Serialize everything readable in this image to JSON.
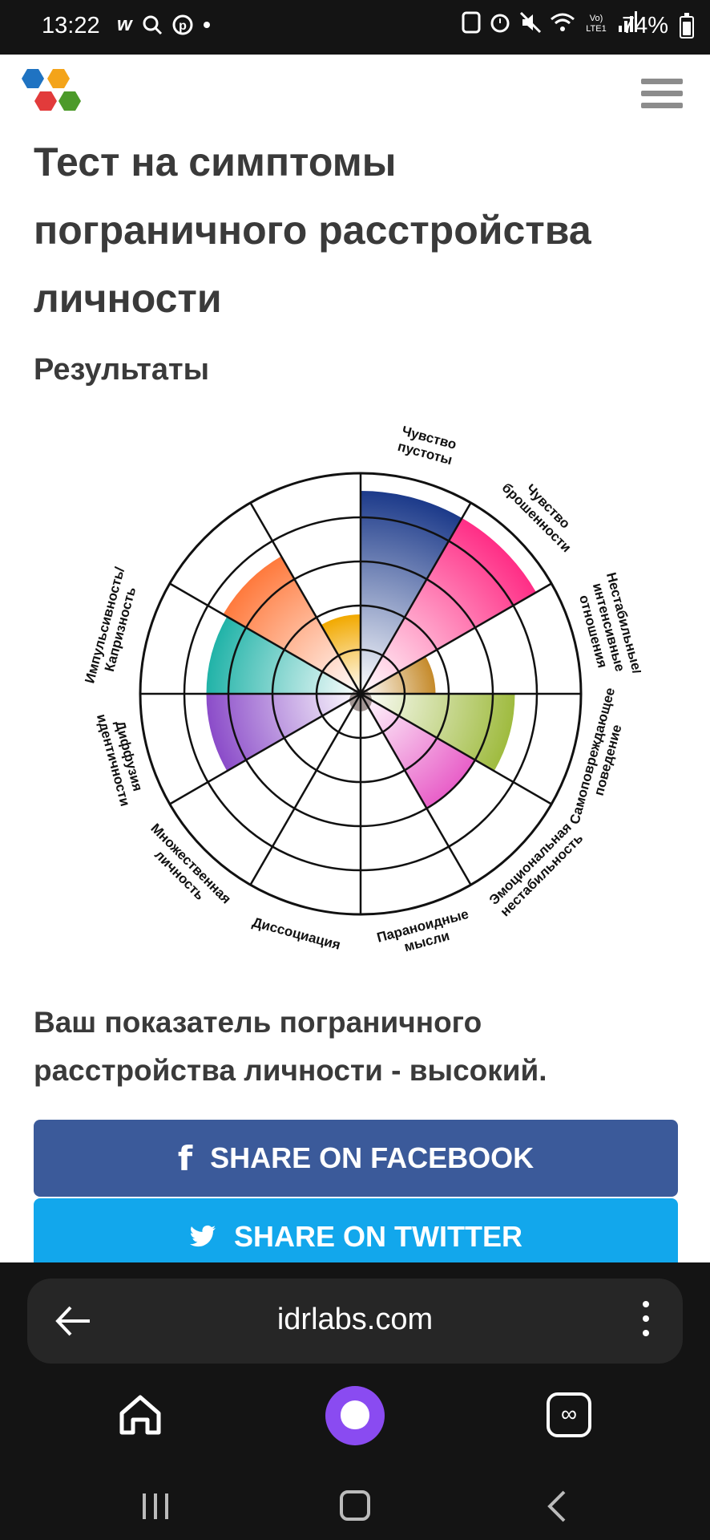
{
  "status_bar": {
    "time": "13:22",
    "battery": "74%",
    "left_icons": [
      "w-app-icon",
      "search-icon",
      "pinterest-icon",
      "dot-icon"
    ],
    "right_icons": [
      "screenshot-icon",
      "alarm-icon",
      "mute-icon",
      "wifi-icon",
      "volte-icon",
      "signal-icon"
    ]
  },
  "header": {
    "logo_icon": "hexagon-logo-icon",
    "menu_icon": "hamburger-menu-icon"
  },
  "content": {
    "title": "Тест на симптомы пограничного расстройства личности",
    "results_heading": "Результаты",
    "score_text": "Ваш показатель пограничного расстройства личности - высокий."
  },
  "chart_data": {
    "type": "polar-area",
    "max": 5,
    "categories": [
      {
        "label": [
          "Чувство",
          "пустоты"
        ],
        "value": 4.6,
        "color": "#1c3a8a"
      },
      {
        "label": [
          "Чувство",
          "брошенности"
        ],
        "value": 4.6,
        "color": "#ff2e86"
      },
      {
        "label": [
          "Нестабильные/",
          "интенсивные",
          "отношения"
        ],
        "value": 1.7,
        "color": "#c58a2a"
      },
      {
        "label": [
          "Самоповреждающее",
          "поведение"
        ],
        "value": 3.5,
        "color": "#9fbb3f"
      },
      {
        "label": [
          "Эмоциональная",
          "нестабильность"
        ],
        "value": 3.0,
        "color": "#e85fc8"
      },
      {
        "label": [
          "Параноидные",
          "мысли"
        ],
        "value": 0.0,
        "color": "#dddddd"
      },
      {
        "label": [
          "Диссоциация"
        ],
        "value": 0.0,
        "color": "#dddddd"
      },
      {
        "label": [
          "Множественная",
          "личность"
        ],
        "value": 0.0,
        "color": "#dddddd"
      },
      {
        "label": [
          "Диффузия",
          "идентичности"
        ],
        "value": 3.5,
        "color": "#8b4cc9"
      },
      {
        "label": [
          "Импульсивность/",
          "Капризность"
        ],
        "value": 3.5,
        "color": "#21b3a8"
      },
      {
        "label": [
          "",
          ""
        ],
        "value": 3.6,
        "color": "#ff7a3d"
      },
      {
        "label": [
          "",
          ""
        ],
        "value": 1.8,
        "color": "#f2a900"
      }
    ],
    "note_center_color": "#7b6a66"
  },
  "share": {
    "facebook": "SHARE ON FACEBOOK",
    "twitter": "SHARE ON TWITTER",
    "facebook_icon": "facebook-f-icon",
    "twitter_icon": "twitter-bird-icon"
  },
  "browser": {
    "url": "idrlabs.com",
    "back_icon": "arrow-left-icon",
    "more_icon": "kebab-menu-icon",
    "home_icon": "home-icon",
    "assistant_icon": "alice-assistant-icon",
    "tabs_icon": "tabs-icon"
  },
  "system_nav": {
    "recent_icon": "recent-apps-icon",
    "home_icon": "system-home-icon",
    "back_icon": "system-back-icon"
  }
}
